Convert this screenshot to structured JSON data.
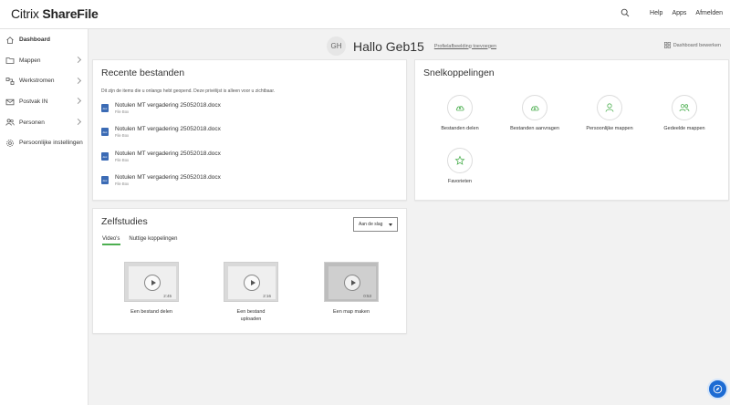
{
  "logo": {
    "brand_light": "Citrix ",
    "brand_bold": "ShareFile"
  },
  "topnav": {
    "help": "Help",
    "apps": "Apps",
    "logout": "Afmelden"
  },
  "sidebar": {
    "items": [
      {
        "label": "Dashboard",
        "icon": "home-icon"
      },
      {
        "label": "Mappen",
        "icon": "folder-icon"
      },
      {
        "label": "Werkstromen",
        "icon": "workflow-icon"
      },
      {
        "label": "Postvak IN",
        "icon": "mail-icon"
      },
      {
        "label": "Personen",
        "icon": "people-icon"
      },
      {
        "label": "Persoonlijke instellingen",
        "icon": "gear-icon"
      }
    ]
  },
  "header": {
    "initials": "GH",
    "greeting": "Hallo Geb15",
    "add_picture": "Profielafbeelding toevoegen",
    "edit_dashboard": "Dashboard bewerken"
  },
  "recent": {
    "title": "Recente bestanden",
    "description": "Dit zijn de items die u onlangs hebt geopend. Deze privélijst is alleen voor u zichtbaar.",
    "files": [
      {
        "name": "Notulen MT vergadering 25052018.docx",
        "location": "File Box"
      },
      {
        "name": "Notulen MT vergadering 25052018.docx",
        "location": "File Box"
      },
      {
        "name": "Notulen MT vergadering 25052018.docx",
        "location": "File Box"
      },
      {
        "name": "Notulen MT vergadering 25052018.docx",
        "location": "File Box"
      }
    ]
  },
  "quick": {
    "title": "Snelkoppelingen",
    "items": [
      {
        "label": "Bestanden delen",
        "icon": "cloud-upload-icon"
      },
      {
        "label": "Bestanden aanvragen",
        "icon": "cloud-download-icon"
      },
      {
        "label": "Persoonlijke mappen",
        "icon": "person-icon"
      },
      {
        "label": "Gedeelde mappen",
        "icon": "shared-people-icon"
      },
      {
        "label": "Favorieten",
        "icon": "star-icon"
      }
    ]
  },
  "tutorials": {
    "title": "Zelfstudies",
    "sort_value": "Aan de slag",
    "tabs": [
      "Video's",
      "Nuttige koppelingen"
    ],
    "videos": [
      {
        "label": "Een bestand delen",
        "duration": "2:45"
      },
      {
        "label": "Een bestand uploaden",
        "duration": "2:16"
      },
      {
        "label": "Een map maken",
        "duration": "0:53"
      }
    ]
  },
  "colors": {
    "accent_green": "#4caf50",
    "file_blue": "#3b6bb5",
    "help_blue": "#1c6bd3"
  }
}
